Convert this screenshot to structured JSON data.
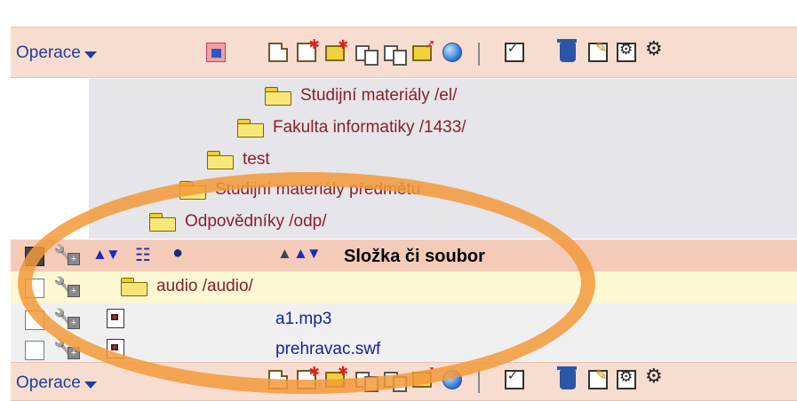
{
  "toolbar": {
    "operations_label": "Operace",
    "icons": [
      "new-file-icon",
      "new-file-star-icon",
      "new-folder-icon",
      "copy-icon",
      "copy-alt-icon",
      "move-icon",
      "globe-icon",
      "select-all-icon",
      "check-all-icon",
      "delete-icon",
      "edit-icon",
      "settings-icon",
      "gears-icon"
    ]
  },
  "breadcrumbs": [
    {
      "label": "Studijní materiály /el/"
    },
    {
      "label": "Fakulta informatiky /1433/"
    },
    {
      "label": "test"
    },
    {
      "label": "Studijní materiály předmětu"
    },
    {
      "label": "Odpovědníky /odp/"
    }
  ],
  "table": {
    "header": {
      "title": "Složka či soubor"
    },
    "rows": [
      {
        "name": "audio /audio/",
        "type": "folder"
      },
      {
        "name": "a1.mp3",
        "type": "file"
      },
      {
        "name": "prehravac.swf",
        "type": "file"
      }
    ]
  },
  "colors": {
    "highlight_ring": "#f39a3a",
    "link": "#8b1f2a",
    "file_link": "#14249a"
  }
}
